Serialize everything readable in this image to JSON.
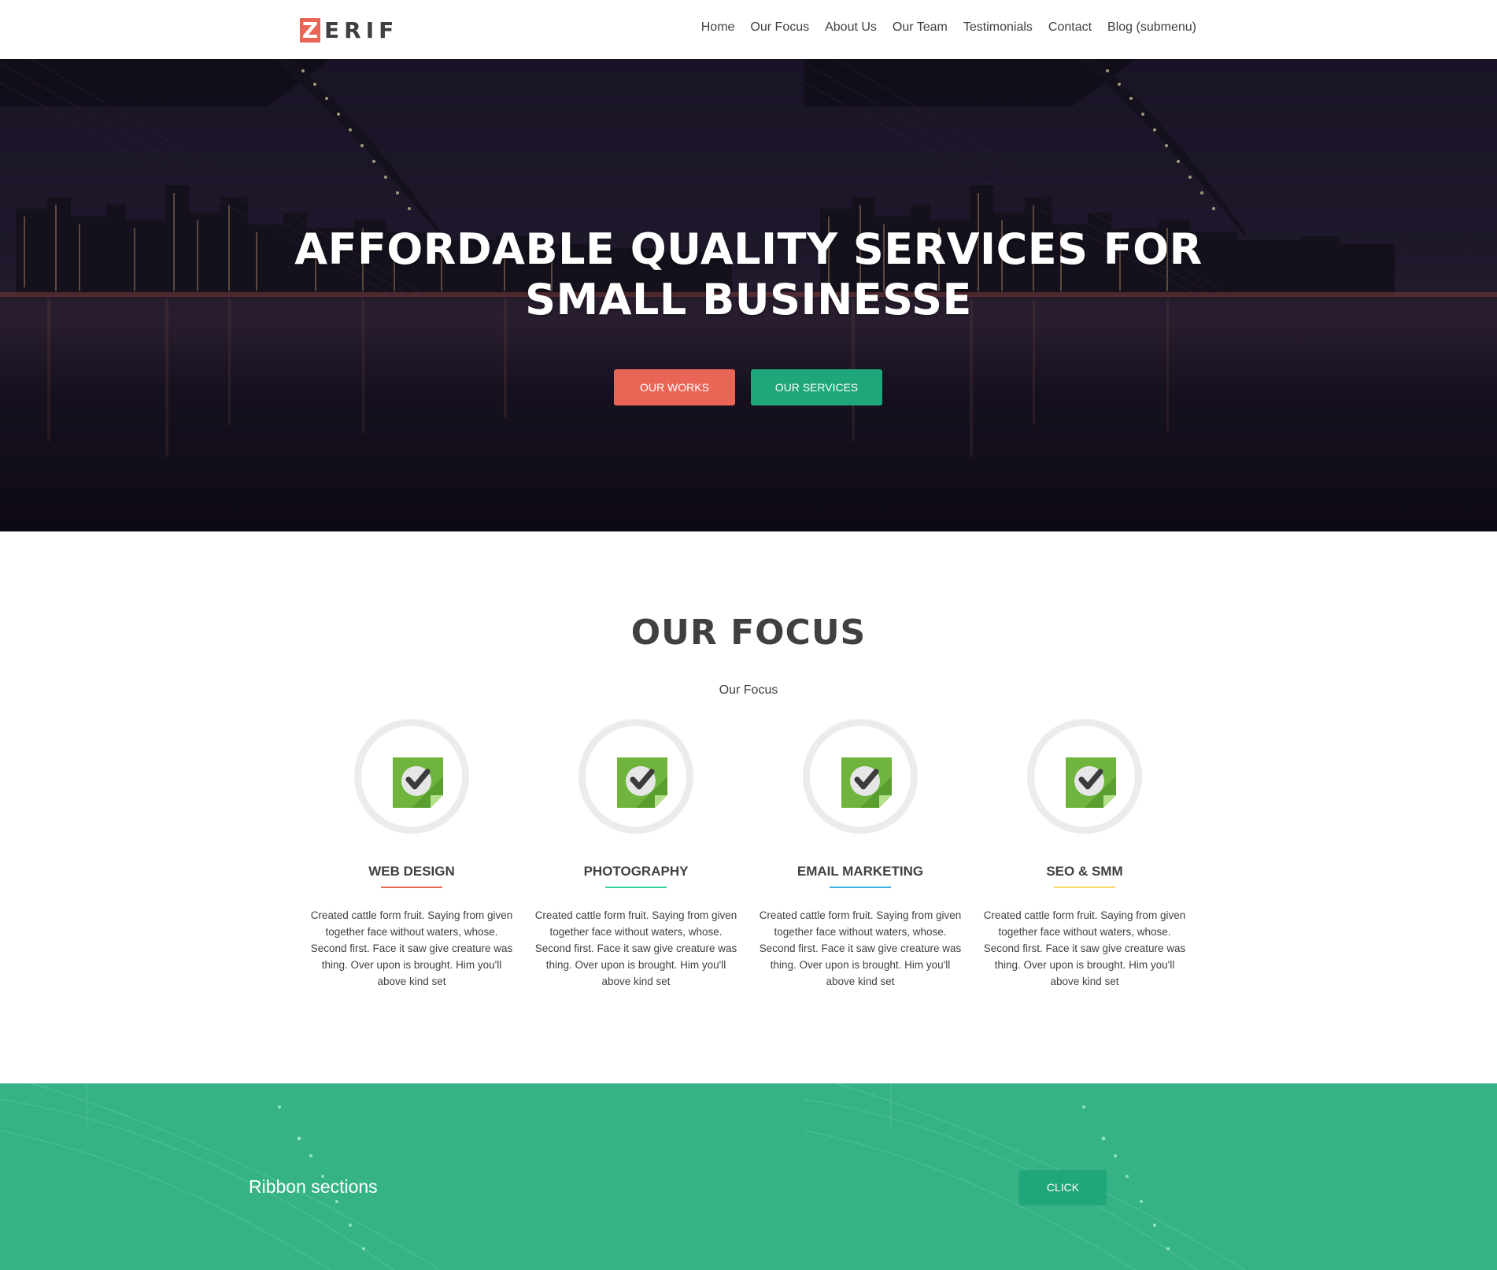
{
  "brand": {
    "logo_letter": "Z",
    "logo_rest": "ERIF"
  },
  "nav": {
    "items": [
      {
        "label": "Home"
      },
      {
        "label": "Our Focus"
      },
      {
        "label": "About Us"
      },
      {
        "label": "Our Team"
      },
      {
        "label": "Testimonials"
      },
      {
        "label": "Contact"
      },
      {
        "label": "Blog (submenu)"
      }
    ]
  },
  "hero": {
    "title_line1": "AFFORDABLE QUALITY SERVICES FOR",
    "title_line2": "SMALL BUSINESSE",
    "btn_works": "OUR WORKS",
    "btn_services": "OUR SERVICES"
  },
  "focus": {
    "title": "OUR FOCUS",
    "subtitle": "Our Focus",
    "items": [
      {
        "name": "WEB DESIGN",
        "accent": "#e96656",
        "icon": "checkmark-sticker-icon",
        "text": "Created cattle form fruit. Saying from given together face without waters, whose. Second first. Face it saw give creature was thing. Over upon is brought. Him you'll above kind set"
      },
      {
        "name": "PHOTOGRAPHY",
        "accent": "#34d293",
        "icon": "checkmark-sticker-icon",
        "text": "Created cattle form fruit. Saying from given together face without waters, whose. Second first. Face it saw give creature was thing. Over upon is brought. Him you'll above kind set"
      },
      {
        "name": "EMAIL MARKETING",
        "accent": "#3ab0e2",
        "icon": "checkmark-sticker-icon",
        "text": "Created cattle form fruit. Saying from given together face without waters, whose. Second first. Face it saw give creature was thing. Over upon is brought. Him you'll above kind set"
      },
      {
        "name": "SEO & SMM",
        "accent": "#f7d861",
        "icon": "checkmark-sticker-icon",
        "text": "Created cattle form fruit. Saying from given together face without waters, whose. Second first. Face it saw give creature was thing. Over upon is brought. Him you'll above kind set"
      }
    ]
  },
  "ribbon": {
    "text": "Ribbon sections",
    "button": "CLICK"
  },
  "colors": {
    "red": "#e96656",
    "green": "#1fa67a",
    "ribbon_bg": "#35b385",
    "text": "#404040"
  }
}
